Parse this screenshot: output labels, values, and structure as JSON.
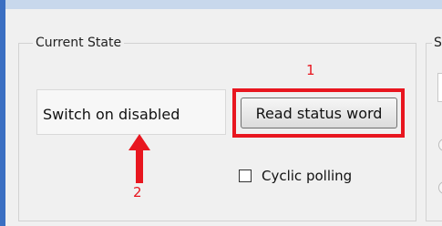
{
  "group": {
    "title": "Current State"
  },
  "right_group": {
    "title": "S"
  },
  "state": {
    "value": "Switch on disabled"
  },
  "buttons": {
    "read_status_word": "Read status word"
  },
  "checkbox": {
    "label": "Cyclic polling",
    "checked": false
  },
  "annotations": {
    "marker_1": "1",
    "marker_2": "2",
    "color": "#e8161f"
  }
}
